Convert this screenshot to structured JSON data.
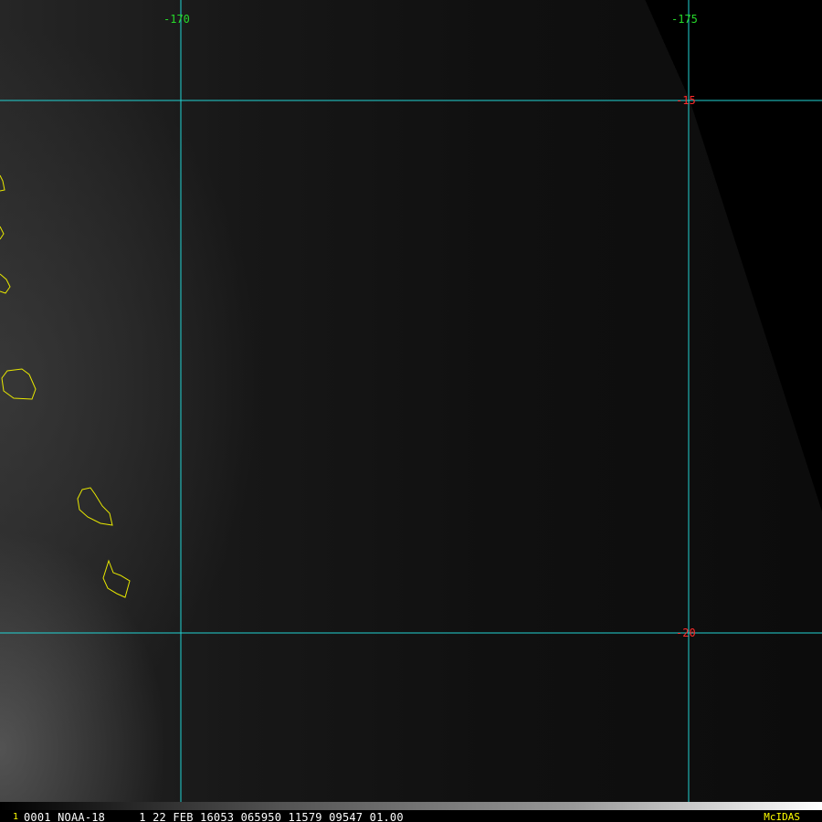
{
  "map": {
    "longitude_labels": [
      "-170",
      "-175"
    ],
    "latitude_labels": [
      "-15",
      "-20"
    ],
    "colors": {
      "gridline": "#22d3d3",
      "coastline": "#e8e800",
      "longitude_label": "#26d82a",
      "latitude_label": "#ff2a2a"
    },
    "coastline_features": [
      "island-outline",
      "island-outline",
      "island-outline",
      "island-outline",
      "island-outline",
      "island-outline"
    ]
  },
  "status_bar": {
    "frame_number": "1",
    "info": "0001 NOAA-18     1 22 FEB 16053 065950 11579 09547 01.00",
    "brand": "McIDAS"
  }
}
